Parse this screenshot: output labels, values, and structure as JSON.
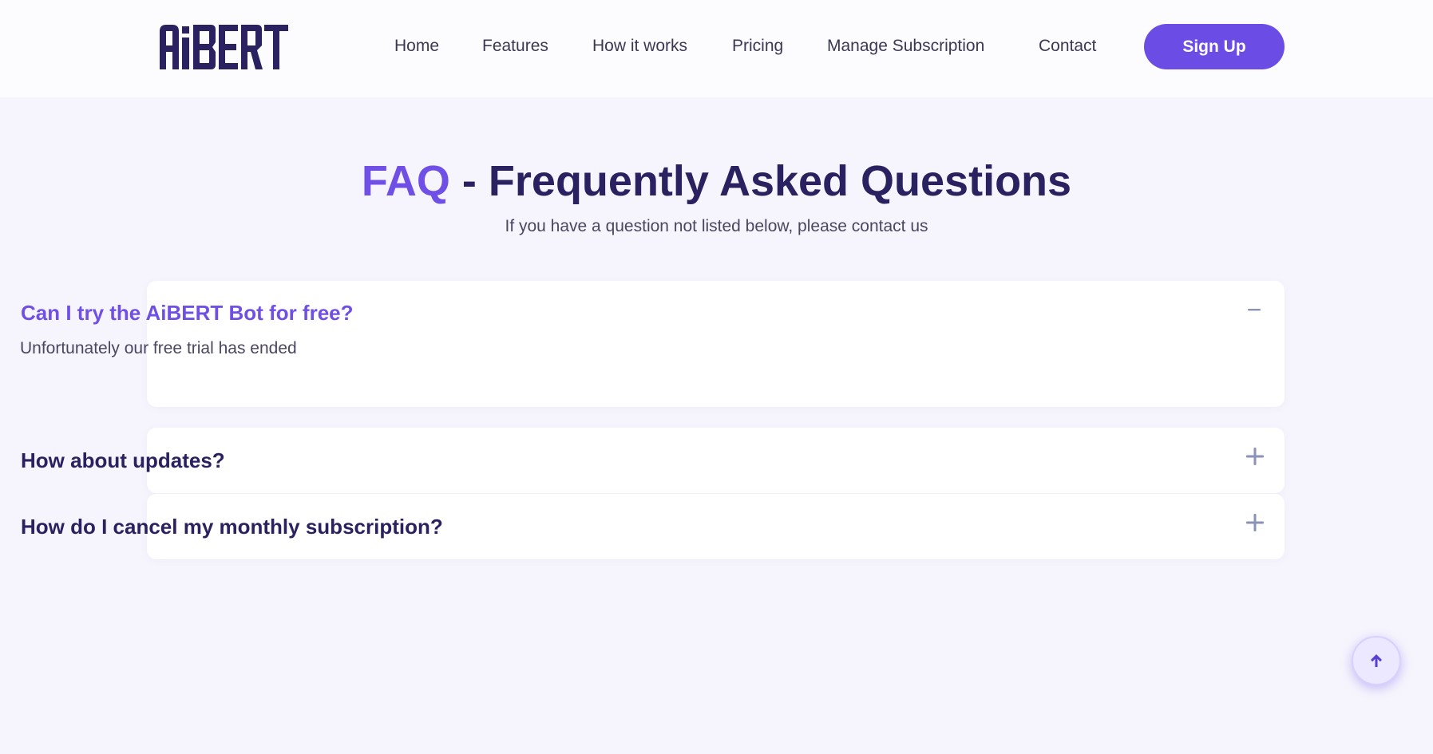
{
  "header": {
    "logo_text": "AiBERT",
    "nav": [
      "Home",
      "Features",
      "How it works",
      "Pricing",
      "Manage Subscription",
      "Contact"
    ],
    "signup_label": "Sign Up"
  },
  "faq": {
    "title_accent": "FAQ",
    "title_rest": " - Frequently Asked Questions",
    "subtitle": "If you have a question not listed below, please contact us",
    "items": [
      {
        "question": "Can I try the AiBERT Bot for free?",
        "answer": "Unfortunately our free trial has ended",
        "expanded": true,
        "icon": "minus-icon"
      },
      {
        "question": "How about updates?",
        "expanded": false,
        "icon": "plus-icon"
      },
      {
        "question": "How do I cancel my monthly subscription?",
        "expanded": false,
        "icon": "plus-icon"
      }
    ]
  },
  "scroll_top_icon": "arrow-up-icon",
  "colors": {
    "brand": "#6b4de6",
    "accent_text": "#6f4fe6",
    "heading": "#2a2160",
    "background": "#f6f5fd",
    "header_background": "#fcfcff",
    "icon_gray": "#8a93b5"
  }
}
